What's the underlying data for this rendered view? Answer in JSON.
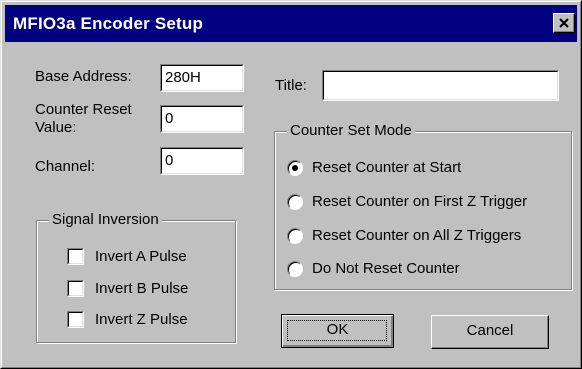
{
  "window": {
    "title": "MFIO3a Encoder Setup"
  },
  "fields": {
    "base_address": {
      "label": "Base Address:",
      "value": "280H"
    },
    "counter_reset": {
      "label_line1": "Counter Reset",
      "label_line2": "Value:",
      "value": "0"
    },
    "channel": {
      "label": "Channel:",
      "value": "0"
    },
    "title": {
      "label": "Title:",
      "value": ""
    }
  },
  "signal_inversion": {
    "legend": "Signal Inversion",
    "options": [
      {
        "label": "Invert A Pulse",
        "checked": false
      },
      {
        "label": "Invert B Pulse",
        "checked": false
      },
      {
        "label": "Invert Z Pulse",
        "checked": false
      }
    ]
  },
  "counter_set_mode": {
    "legend": "Counter Set Mode",
    "options": [
      {
        "label": "Reset Counter at Start",
        "selected": true
      },
      {
        "label": "Reset Counter on First Z Trigger",
        "selected": false
      },
      {
        "label": "Reset Counter on All Z Triggers",
        "selected": false
      },
      {
        "label": "Do Not Reset Counter",
        "selected": false
      }
    ]
  },
  "buttons": {
    "ok": "OK",
    "cancel": "Cancel"
  }
}
